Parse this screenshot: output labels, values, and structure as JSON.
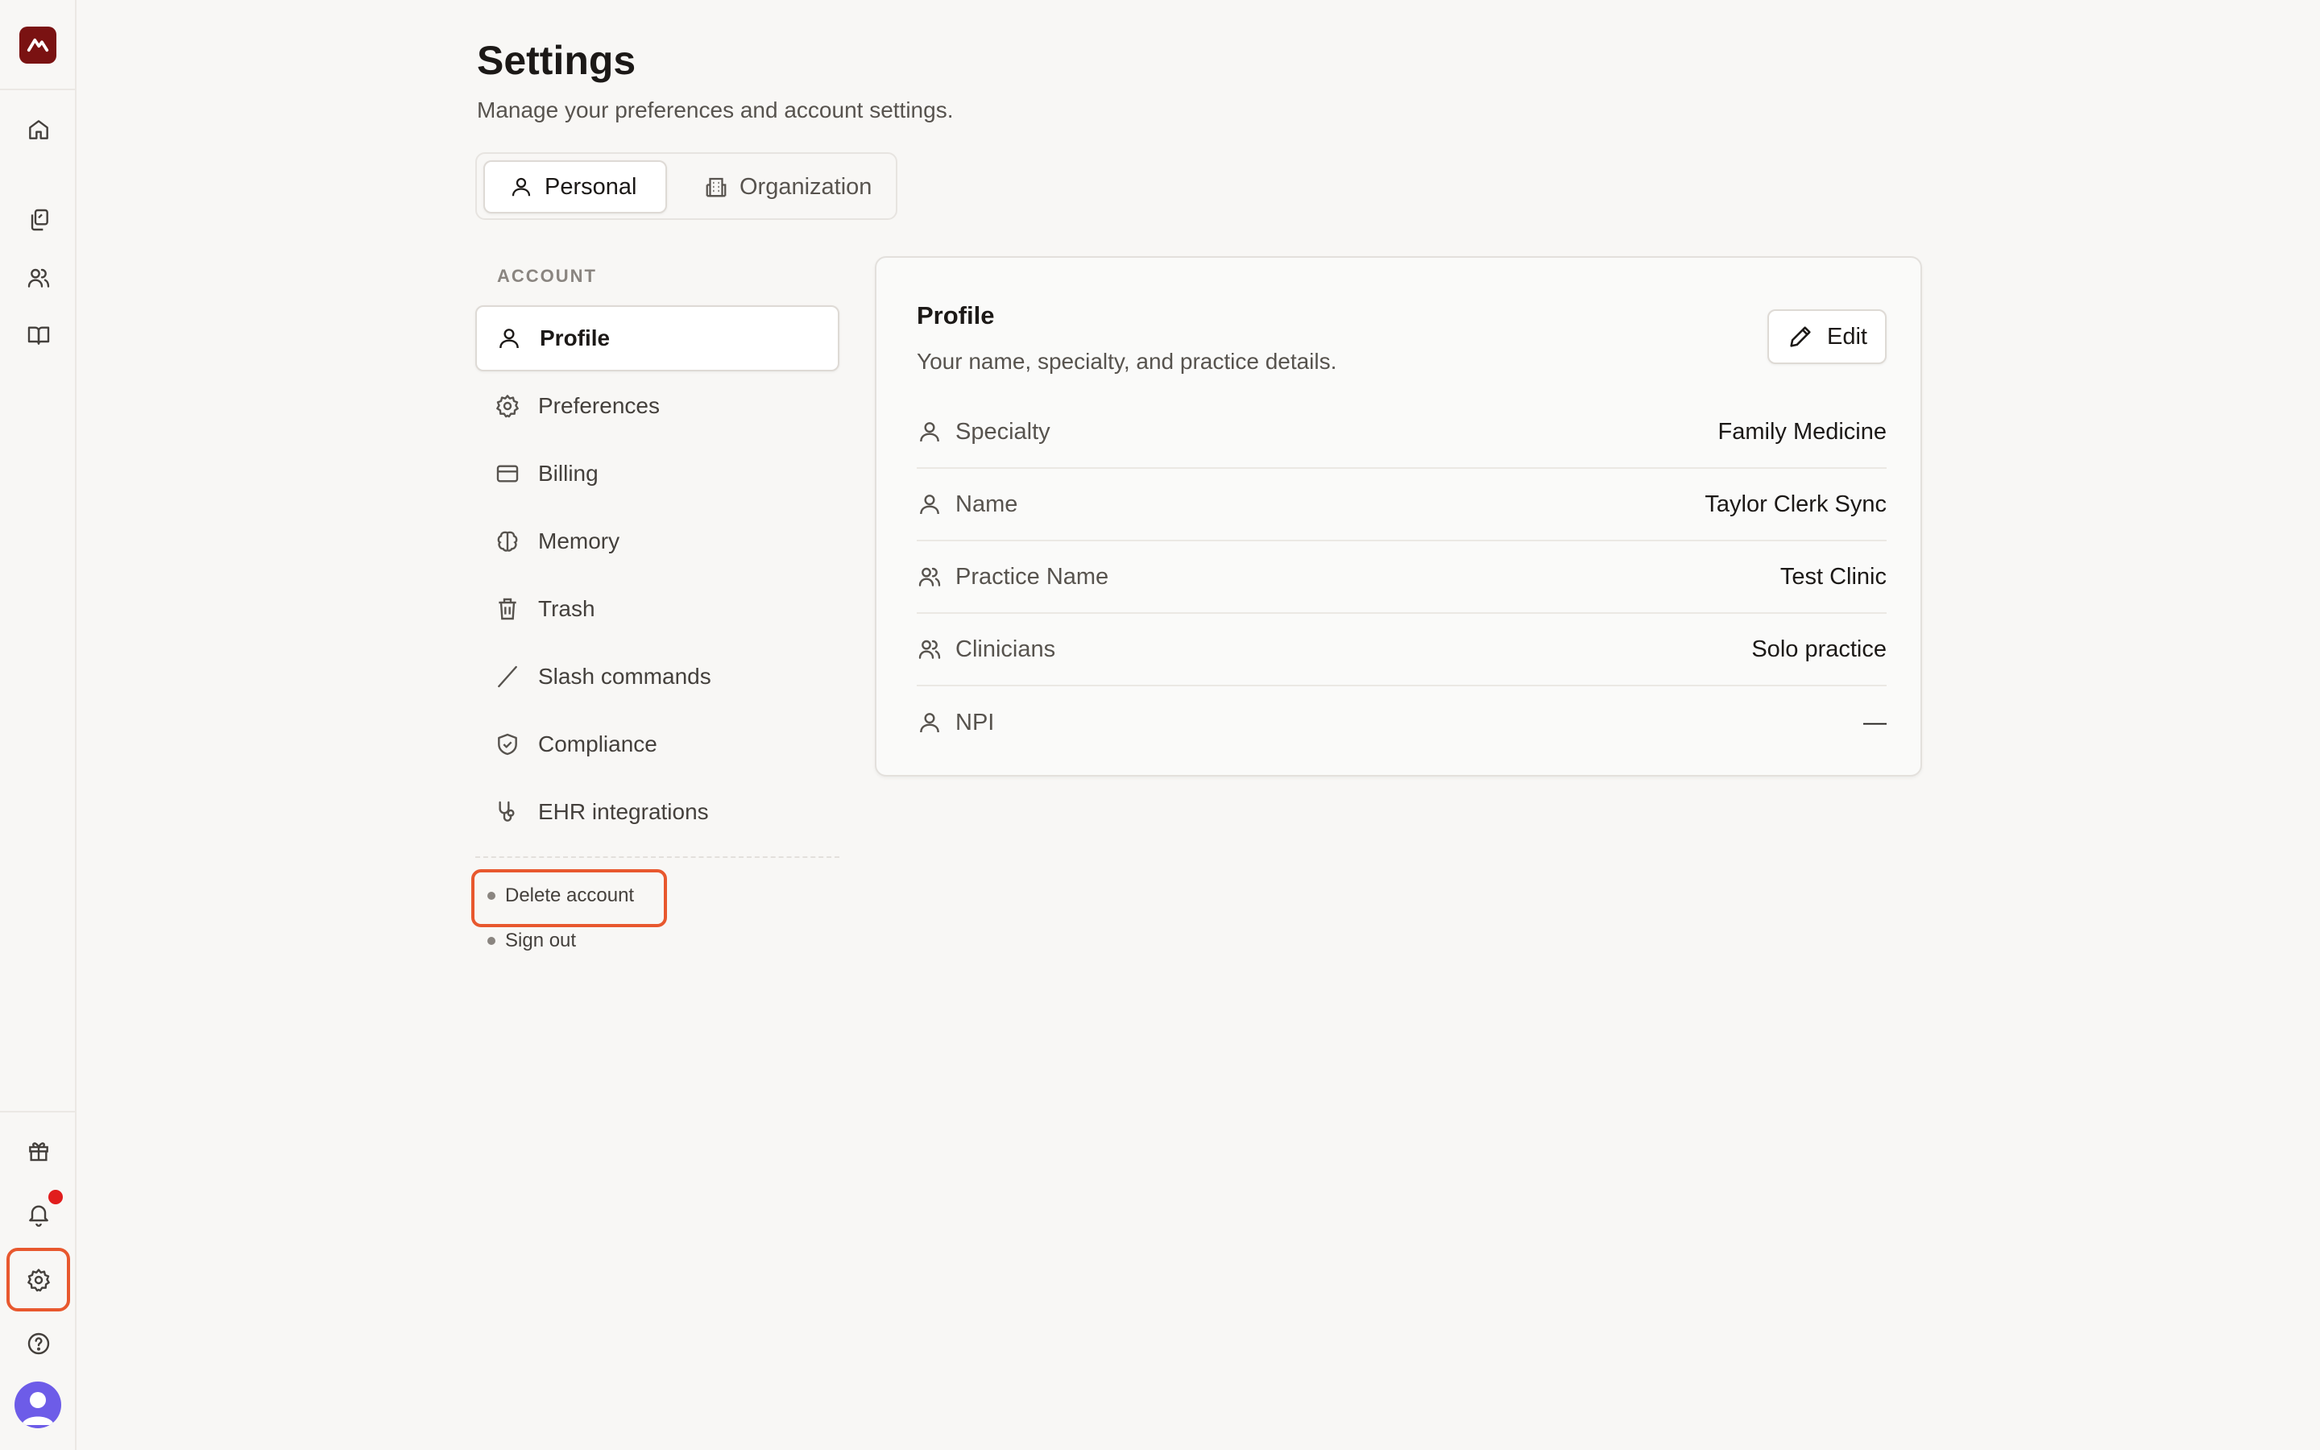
{
  "header": {
    "title": "Settings",
    "subtitle": "Manage your preferences and account settings."
  },
  "tabs": [
    {
      "label": "Personal",
      "icon": "user-icon",
      "active": true
    },
    {
      "label": "Organization",
      "icon": "building-icon",
      "active": false
    }
  ],
  "sidebar": {
    "section_label": "ACCOUNT",
    "items": [
      {
        "label": "Profile",
        "icon": "user-icon",
        "active": true
      },
      {
        "label": "Preferences",
        "icon": "gear-icon"
      },
      {
        "label": "Billing",
        "icon": "credit-card-icon"
      },
      {
        "label": "Memory",
        "icon": "brain-icon"
      },
      {
        "label": "Trash",
        "icon": "trash-icon"
      },
      {
        "label": "Slash commands",
        "icon": "slash-icon"
      },
      {
        "label": "Compliance",
        "icon": "shield-check-icon"
      },
      {
        "label": "EHR integrations",
        "icon": "stethoscope-icon"
      }
    ],
    "links": {
      "delete_account": "Delete account",
      "sign_out": "Sign out"
    }
  },
  "profile_card": {
    "title": "Profile",
    "subtitle": "Your name, specialty, and practice details.",
    "edit_label": "Edit",
    "fields": [
      {
        "label": "Specialty",
        "value": "Family Medicine",
        "icon": "user-icon"
      },
      {
        "label": "Name",
        "value": "Taylor Clerk Sync",
        "icon": "user-icon"
      },
      {
        "label": "Practice Name",
        "value": "Test Clinic",
        "icon": "users-icon"
      },
      {
        "label": "Clinicians",
        "value": "Solo practice",
        "icon": "users-icon"
      },
      {
        "label": "NPI",
        "value": "—",
        "icon": "user-icon"
      }
    ]
  },
  "rail": {
    "icons": [
      "home-icon",
      "documents-icon",
      "users-icon",
      "book-icon",
      "gift-icon",
      "bell-icon",
      "gear-icon",
      "help-icon",
      "avatar"
    ],
    "active": "gear-icon",
    "notification_dot_color": "#e11d1d",
    "brand_color": "#7a1212",
    "highlight_color": "#e8582e"
  }
}
